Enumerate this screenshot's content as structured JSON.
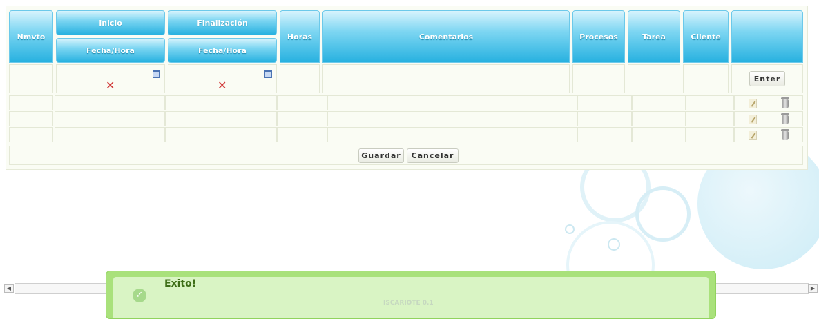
{
  "table": {
    "headers": {
      "nmvto": "Nmvto",
      "inicio": "Inicio",
      "inicio_sub": "Fecha/Hora",
      "finalizacion": "Finalización",
      "finalizacion_sub": "Fecha/Hora",
      "horas": "Horas",
      "comentarios": "Comentarios",
      "procesos": "Procesos",
      "tarea": "Tarea",
      "cliente": "Cliente"
    },
    "enter_label": "Enter",
    "rows": [
      {
        "nmvto": "",
        "inicio": "",
        "fin": "",
        "horas": "",
        "comentarios": "",
        "procesos": "",
        "tarea": "",
        "cliente": ""
      },
      {
        "nmvto": "",
        "inicio": "",
        "fin": "",
        "horas": "",
        "comentarios": "",
        "procesos": "",
        "tarea": "",
        "cliente": ""
      },
      {
        "nmvto": "",
        "inicio": "",
        "fin": "",
        "horas": "",
        "comentarios": "",
        "procesos": "",
        "tarea": "",
        "cliente": ""
      }
    ],
    "save_label": "Guardar",
    "cancel_label": "Cancelar"
  },
  "toast": {
    "title": "Exito!",
    "icon": "check-circle-icon",
    "color": "#a9e17b"
  },
  "footer": {
    "app_name": "ISCARIOTE 0.1"
  },
  "colors": {
    "header_blue": "#27b1e0",
    "success_green": "#a9e17b"
  }
}
